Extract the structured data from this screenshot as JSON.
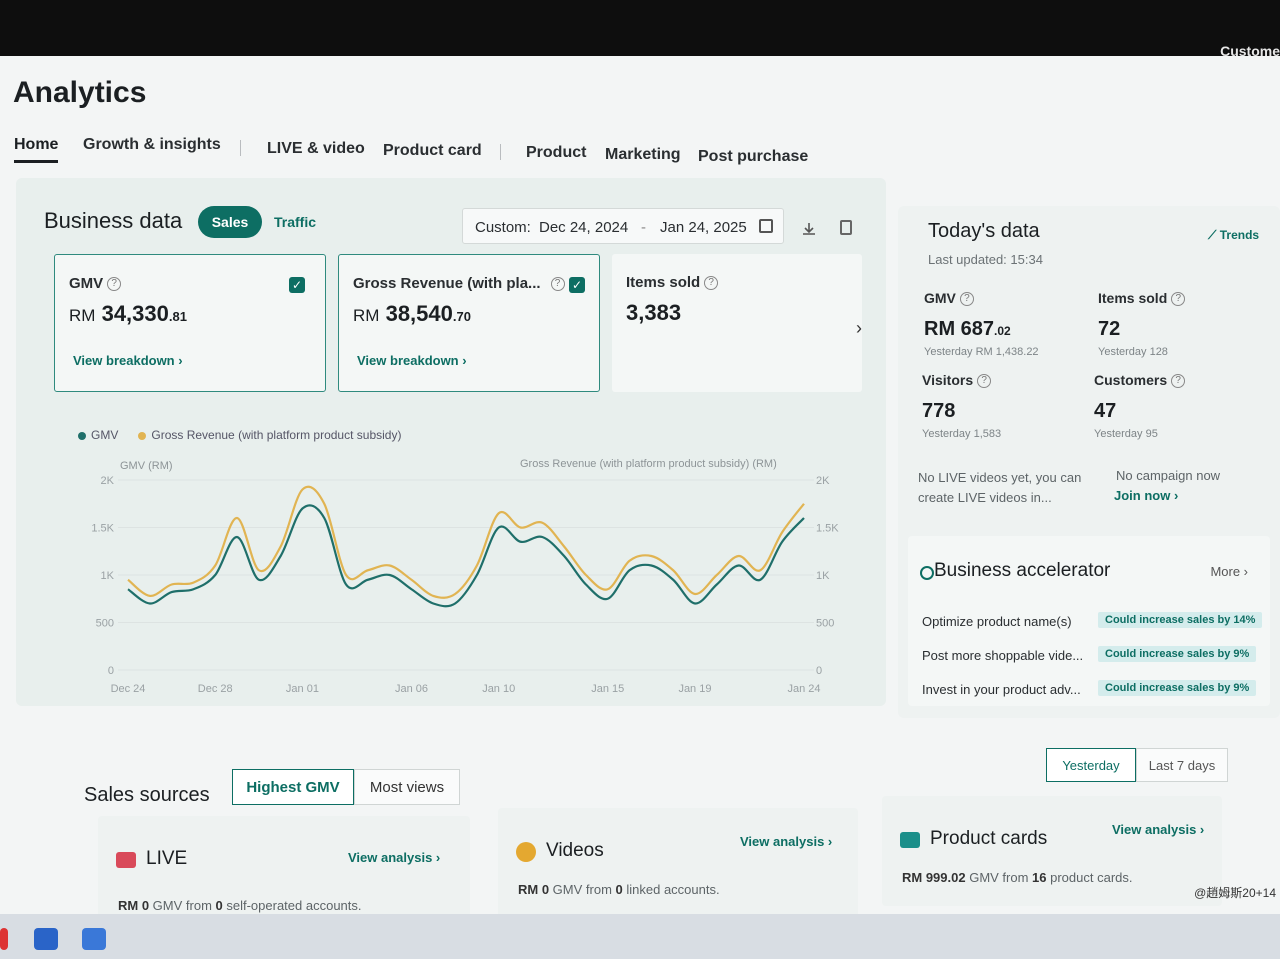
{
  "topbar": {
    "customer_label": "Custome"
  },
  "page": {
    "title": "Analytics"
  },
  "nav": {
    "tabs": [
      "Home",
      "Growth & insights",
      "LIVE & video",
      "Product card",
      "Product",
      "Marketing",
      "Post purchase"
    ],
    "active": "Home"
  },
  "business": {
    "title": "Business data",
    "toggle_sales": "Sales",
    "toggle_traffic": "Traffic",
    "date_prefix": "Custom:",
    "date_start": "Dec 24, 2024",
    "date_sep": "-",
    "date_end": "Jan 24, 2025",
    "kpis": [
      {
        "label": "GMV",
        "currency": "RM",
        "value": "34,330",
        "cents": ".81",
        "link": "View breakdown ›",
        "checked": true
      },
      {
        "label": "Gross Revenue (with pla...",
        "currency": "RM",
        "value": "38,540",
        "cents": ".70",
        "link": "View breakdown ›",
        "checked": true
      },
      {
        "label": "Items sold",
        "value": "3,383"
      }
    ]
  },
  "chart_data": {
    "type": "line",
    "legend": [
      "GMV",
      "Gross Revenue (with platform product subsidy)"
    ],
    "ylabel_left": "GMV (RM)",
    "ylabel_right": "Gross Revenue (with platform product subsidy) (RM)",
    "yticks_left": [
      "2K",
      "1.5K",
      "1K",
      "500",
      "0"
    ],
    "yticks_right": [
      "2K",
      "1.5K",
      "1K",
      "500",
      "0"
    ],
    "ylim": [
      0,
      2000
    ],
    "x_ticks": [
      "Dec 24",
      "Dec 28",
      "Jan 01",
      "Jan 06",
      "Jan 10",
      "Jan 15",
      "Jan 19",
      "Jan 24"
    ],
    "x": [
      "Dec 24",
      "Dec 25",
      "Dec 26",
      "Dec 27",
      "Dec 28",
      "Dec 29",
      "Dec 30",
      "Dec 31",
      "Jan 01",
      "Jan 02",
      "Jan 03",
      "Jan 04",
      "Jan 05",
      "Jan 06",
      "Jan 07",
      "Jan 08",
      "Jan 09",
      "Jan 10",
      "Jan 11",
      "Jan 12",
      "Jan 13",
      "Jan 14",
      "Jan 15",
      "Jan 16",
      "Jan 17",
      "Jan 18",
      "Jan 19",
      "Jan 20",
      "Jan 21",
      "Jan 22",
      "Jan 23",
      "Jan 24"
    ],
    "series": [
      {
        "name": "GMV",
        "color": "#1f6f6a",
        "values": [
          850,
          700,
          820,
          850,
          1000,
          1400,
          950,
          1200,
          1700,
          1600,
          900,
          950,
          1000,
          850,
          700,
          700,
          1000,
          1500,
          1350,
          1400,
          1200,
          900,
          750,
          1050,
          1100,
          950,
          700,
          900,
          1100,
          950,
          1350,
          1600
        ]
      },
      {
        "name": "Gross Revenue (with platform product subsidy)",
        "color": "#e1b452",
        "values": [
          950,
          780,
          900,
          920,
          1100,
          1600,
          1050,
          1300,
          1900,
          1750,
          1000,
          1050,
          1100,
          950,
          780,
          800,
          1100,
          1650,
          1500,
          1550,
          1300,
          1000,
          850,
          1150,
          1200,
          1050,
          800,
          1000,
          1200,
          1050,
          1450,
          1750
        ]
      }
    ]
  },
  "today": {
    "title": "Today's data",
    "updated": "Last updated: 15:34",
    "trends": "Trends",
    "metrics": [
      {
        "label": "GMV",
        "value": "RM 687",
        "cents": ".02",
        "sub": "Yesterday RM 1,438.22"
      },
      {
        "label": "Items sold",
        "value": "72",
        "sub": "Yesterday 128"
      },
      {
        "label": "Visitors",
        "value": "778",
        "sub": "Yesterday 1,583"
      },
      {
        "label": "Customers",
        "value": "47",
        "sub": "Yesterday 95"
      }
    ],
    "live_note": "No LIVE videos yet, you can create LIVE videos in...",
    "campaign_note": "No campaign now",
    "join": "Join now ›"
  },
  "accelerator": {
    "title": "Business accelerator",
    "more": "More ›",
    "rows": [
      {
        "label": "Optimize product name(s)",
        "badge": "Could increase sales by 14%"
      },
      {
        "label": "Post more shoppable vide...",
        "badge": "Could increase sales by 9%"
      },
      {
        "label": "Invest in your product adv...",
        "badge": "Could increase sales by 9%"
      }
    ]
  },
  "sources": {
    "title": "Sales sources",
    "seg_active": "Highest GMV",
    "seg_inactive": "Most views",
    "period_active": "Yesterday",
    "period_inactive": "Last 7 days",
    "cards": [
      {
        "title": "LIVE",
        "link": "View analysis ›",
        "desc_prefix": "RM 0",
        "desc_mid": " GMV from ",
        "desc_count": "0",
        "desc_suffix": " self-operated accounts."
      },
      {
        "title": "Videos",
        "link": "View analysis ›",
        "desc_prefix": "RM 0",
        "desc_mid": " GMV from ",
        "desc_count": "0",
        "desc_suffix": " linked accounts."
      },
      {
        "title": "Product cards",
        "link": "View analysis ›",
        "desc_prefix": "RM 999.02",
        "desc_mid": " GMV from ",
        "desc_count": "16",
        "desc_suffix": " product cards."
      }
    ]
  },
  "taskbar": {
    "tray_text": "@趙姆斯20+14"
  }
}
